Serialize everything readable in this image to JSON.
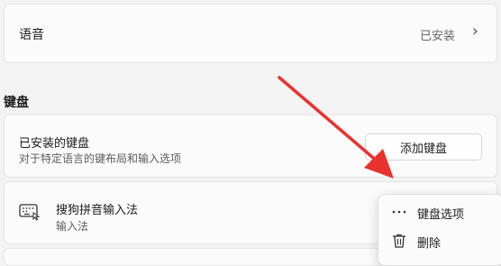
{
  "language_row": {
    "title": "语音",
    "status": "已安装",
    "chevron": "chevron-right-icon"
  },
  "keyboard_section": {
    "title": "键盘"
  },
  "installed_keyboards": {
    "title": "已安装的键盘",
    "subtitle": "对于特定语言的键布局和输入选项",
    "add_button": "添加键盘"
  },
  "ime": {
    "icon": "keyboard-icon",
    "name": "搜狗拼音输入法",
    "subtitle": "输入法"
  },
  "context_menu": {
    "items": [
      {
        "icon": "more-icon",
        "label": "键盘选项"
      },
      {
        "icon": "trash-icon",
        "label": "删除"
      }
    ]
  },
  "annotation": {
    "color": "#e8322e"
  }
}
